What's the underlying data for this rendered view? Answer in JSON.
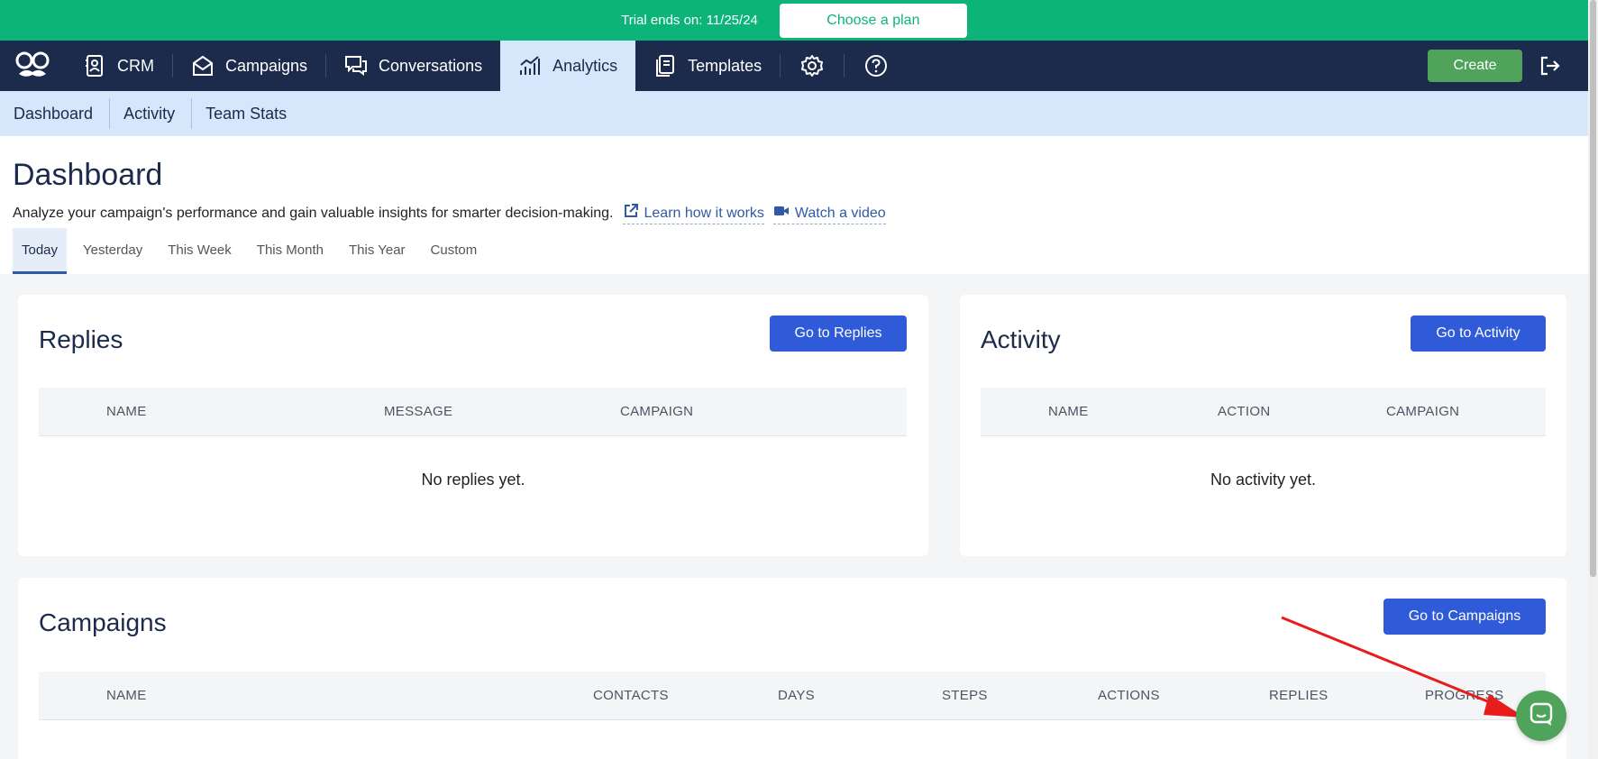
{
  "trial": {
    "text": "Trial ends on: 11/25/24",
    "cta": "Choose a plan"
  },
  "nav": {
    "items": [
      {
        "label": "CRM",
        "icon": "contact-book-icon"
      },
      {
        "label": "Campaigns",
        "icon": "envelope-icon"
      },
      {
        "label": "Conversations",
        "icon": "chat-bubbles-icon"
      },
      {
        "label": "Analytics",
        "icon": "bar-chart-icon",
        "active": true
      },
      {
        "label": "Templates",
        "icon": "document-icon"
      }
    ],
    "create_label": "Create"
  },
  "subnav": {
    "items": [
      "Dashboard",
      "Activity",
      "Team Stats"
    ]
  },
  "page": {
    "title": "Dashboard",
    "subtitle": "Analyze your campaign's performance and gain valuable insights for smarter decision-making.",
    "learn_link": "Learn how it works",
    "video_link": "Watch a video"
  },
  "tabs": [
    "Today",
    "Yesterday",
    "This Week",
    "This Month",
    "This Year",
    "Custom"
  ],
  "replies": {
    "title": "Replies",
    "button": "Go to Replies",
    "columns": [
      "NAME",
      "MESSAGE",
      "CAMPAIGN"
    ],
    "empty": "No replies yet."
  },
  "activity": {
    "title": "Activity",
    "button": "Go to Activity",
    "columns": [
      "NAME",
      "ACTION",
      "CAMPAIGN"
    ],
    "empty": "No activity yet."
  },
  "campaigns": {
    "title": "Campaigns",
    "button": "Go to Campaigns",
    "columns": [
      "NAME",
      "CONTACTS",
      "DAYS",
      "STEPS",
      "ACTIONS",
      "REPLIES",
      "PROGRESS"
    ]
  },
  "colors": {
    "brand_green": "#0db47a",
    "nav_dark": "#1c2b4b",
    "accent_blue": "#2f5ad8",
    "annotation_red": "#e81c1c"
  }
}
